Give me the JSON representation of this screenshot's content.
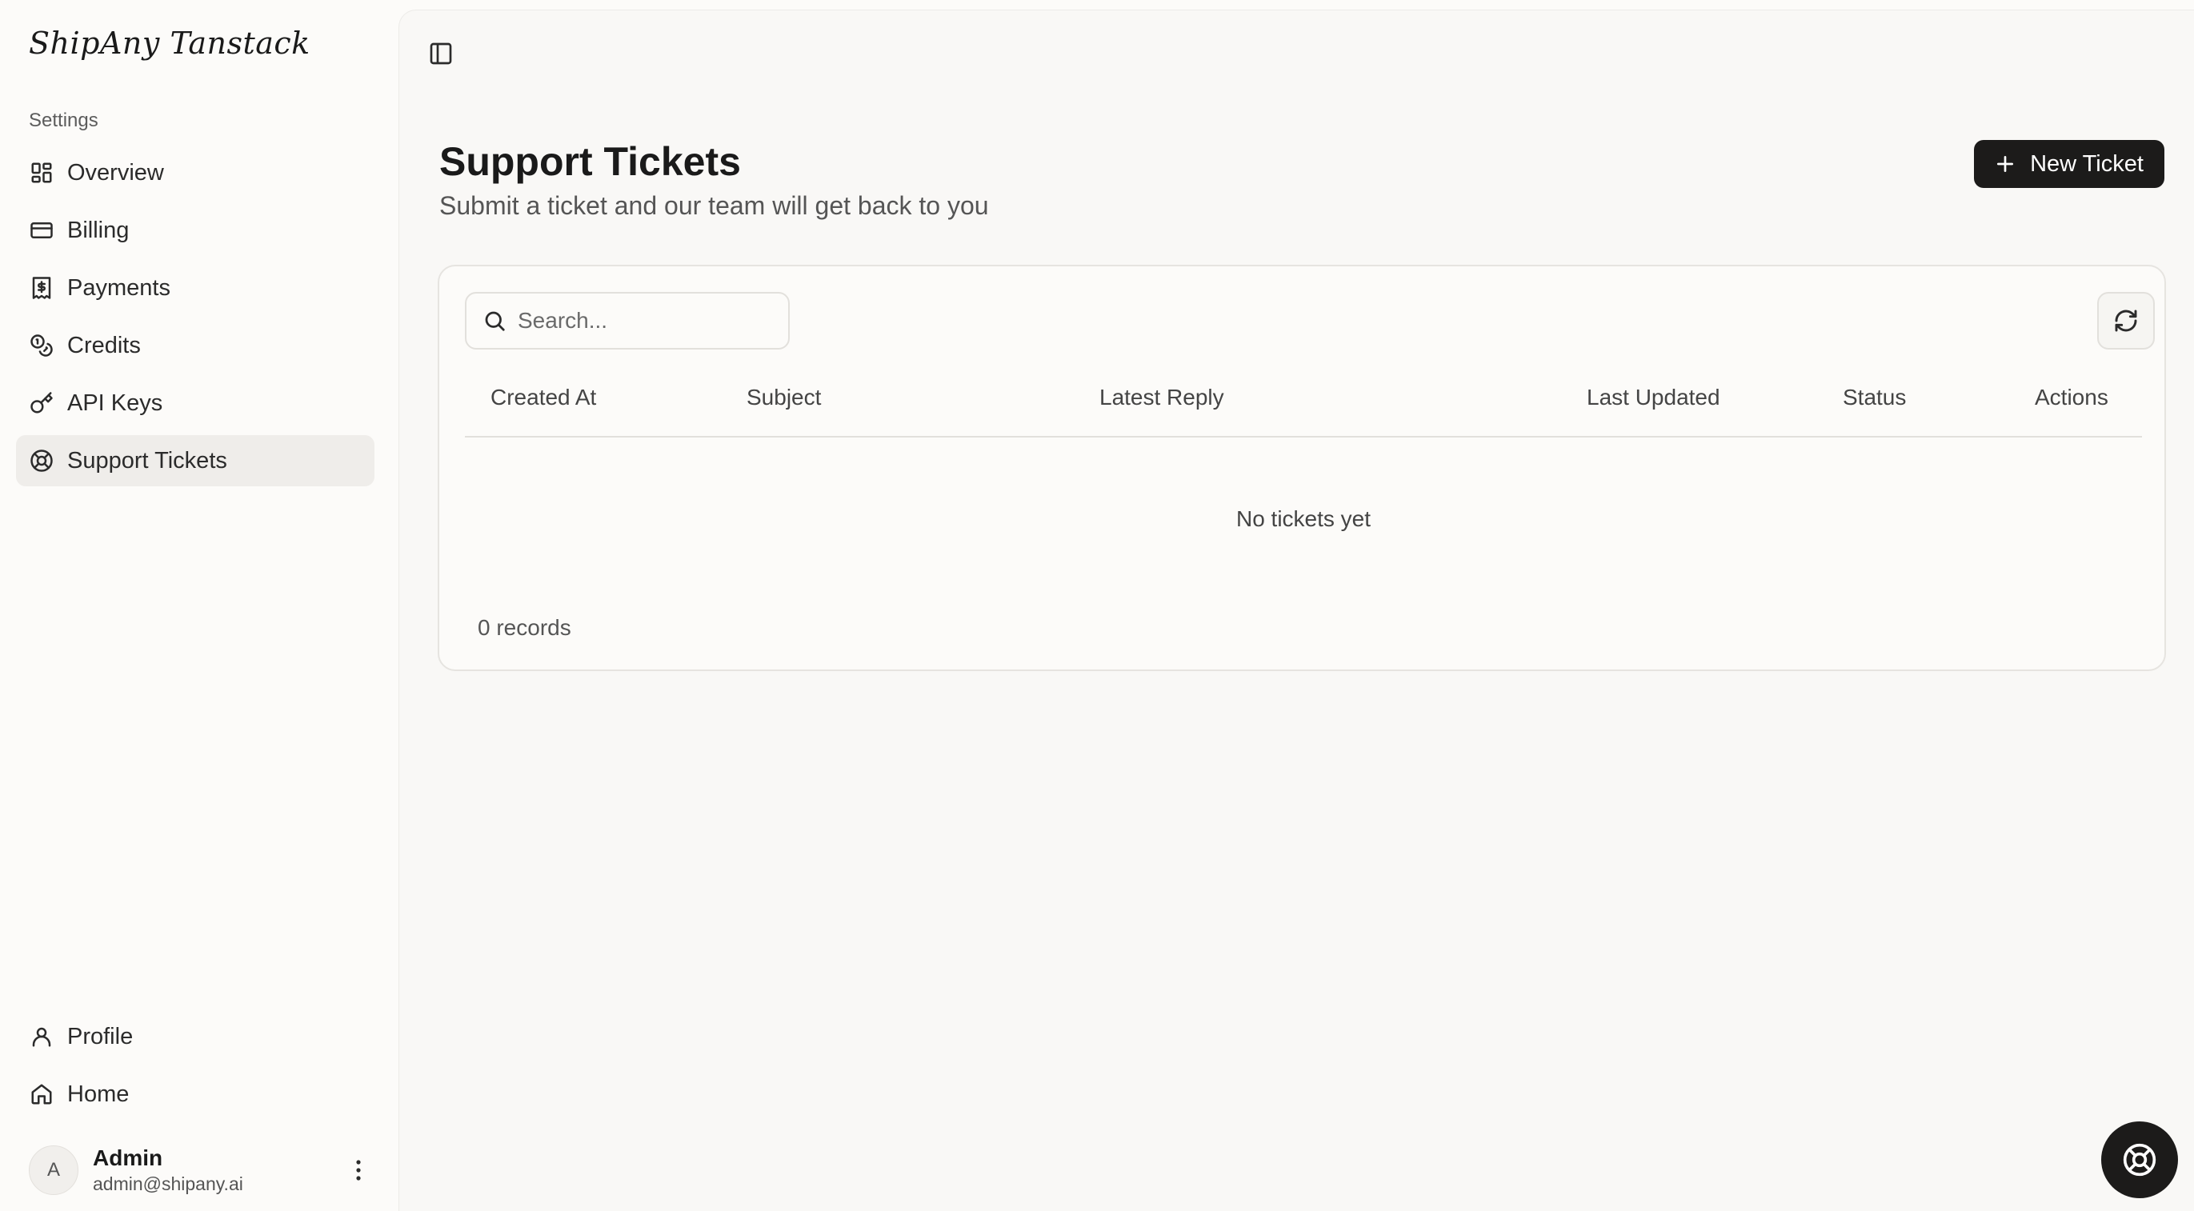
{
  "app": {
    "brand": "ShipAny Tanstack"
  },
  "sidebar": {
    "group_label": "Settings",
    "items": [
      {
        "label": "Overview",
        "icon": "layout-dashboard-icon"
      },
      {
        "label": "Billing",
        "icon": "credit-card-icon"
      },
      {
        "label": "Payments",
        "icon": "receipt-dollar-icon"
      },
      {
        "label": "Credits",
        "icon": "coins-icon"
      },
      {
        "label": "API Keys",
        "icon": "key-icon"
      },
      {
        "label": "Support Tickets",
        "icon": "life-buoy-icon",
        "active": true
      }
    ],
    "bottom_items": [
      {
        "label": "Profile",
        "icon": "user-icon"
      },
      {
        "label": "Home",
        "icon": "home-icon"
      }
    ],
    "user": {
      "initial": "A",
      "name": "Admin",
      "email": "admin@shipany.ai"
    }
  },
  "main": {
    "title": "Support Tickets",
    "subtitle": "Submit a ticket and our team will get back to you",
    "new_button_label": "New Ticket",
    "search": {
      "placeholder": "Search...",
      "value": ""
    },
    "table": {
      "columns": [
        "Created At",
        "Subject",
        "Latest Reply",
        "Last Updated",
        "Status",
        "Actions"
      ],
      "rows": [],
      "empty_text": "No tickets yet",
      "records_text": "0 records"
    }
  },
  "colors": {
    "background": "#fcfbf9",
    "primary_button": "#1c1b1a",
    "active_nav": "#efedea",
    "border": "#e6e4e0"
  }
}
